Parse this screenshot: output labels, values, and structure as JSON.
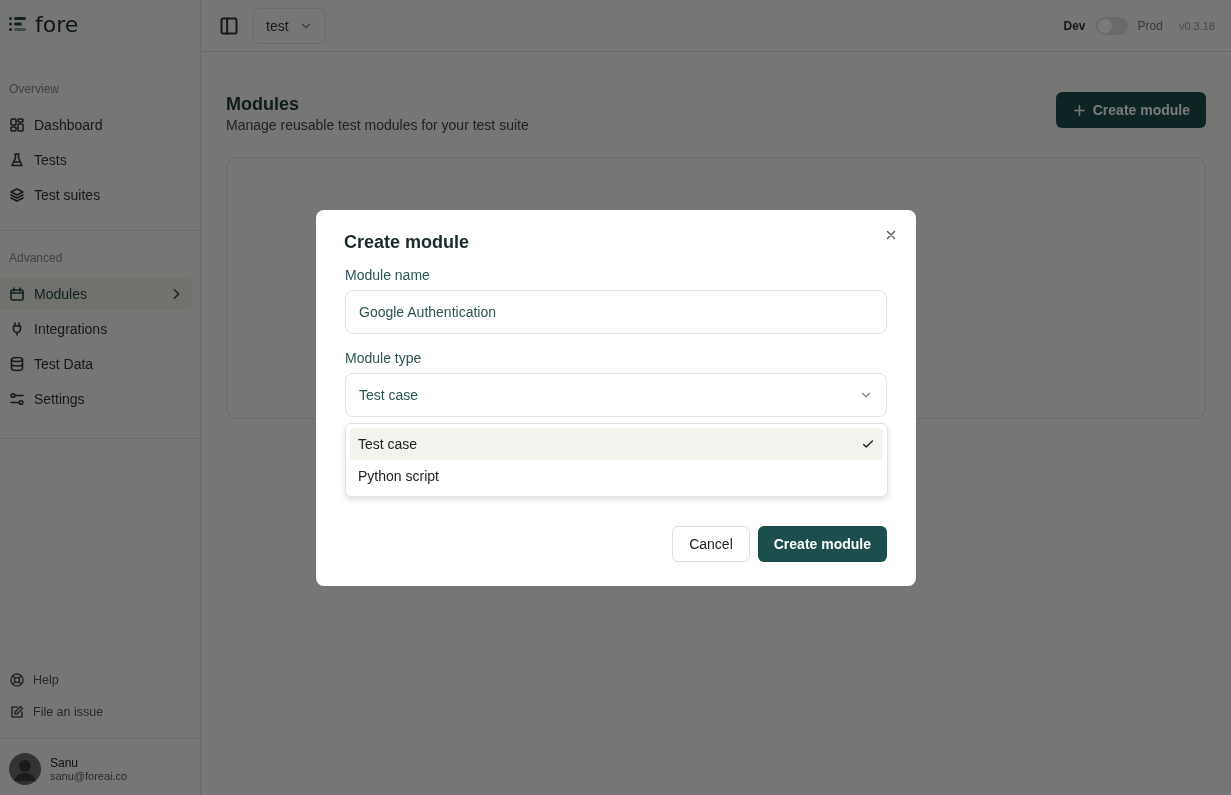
{
  "brand": {
    "name": "fore"
  },
  "topbar": {
    "project": "test",
    "env_left": "Dev",
    "env_right": "Prod",
    "env_on": false,
    "version": "v0.3.18"
  },
  "sidebar": {
    "sections": [
      {
        "title": "Overview",
        "items": [
          {
            "label": "Dashboard",
            "selected": false
          },
          {
            "label": "Tests",
            "selected": false
          },
          {
            "label": "Test suites",
            "selected": false
          }
        ]
      },
      {
        "title": "Advanced",
        "items": [
          {
            "label": "Modules",
            "selected": true
          },
          {
            "label": "Integrations",
            "selected": false
          },
          {
            "label": "Test Data",
            "selected": false
          },
          {
            "label": "Settings",
            "selected": false
          }
        ]
      }
    ],
    "footer": [
      {
        "label": "Help"
      },
      {
        "label": "File an issue"
      }
    ],
    "user": {
      "name": "Sanu",
      "email": "sanu@foreai.co"
    }
  },
  "page": {
    "title": "Modules",
    "subtitle": "Manage reusable test modules for your test suite",
    "action": "Create module"
  },
  "dialog": {
    "title": "Create module",
    "name_label": "Module name",
    "name_value": "Google Authentication",
    "type_label": "Module type",
    "type_value": "Test case",
    "options": [
      {
        "label": "Test case",
        "selected": true
      },
      {
        "label": "Python script",
        "selected": false
      }
    ],
    "buttons": [
      {
        "label": "Cancel",
        "kind": "secondary"
      },
      {
        "label": "Create module",
        "kind": "primary"
      }
    ]
  }
}
